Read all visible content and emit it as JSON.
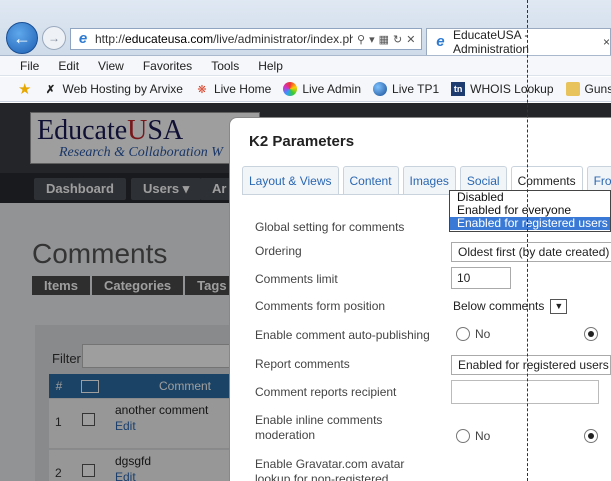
{
  "browser": {
    "url_prefix": "http://",
    "url_host": "educateusa.com",
    "url_path": "/live/administrator/index.ph",
    "tab_title": "EducateUSA - Administration",
    "tab_close": "×"
  },
  "menu": [
    "File",
    "Edit",
    "View",
    "Favorites",
    "Tools",
    "Help"
  ],
  "favorites": [
    {
      "label": "Web Hosting by Arvixe",
      "icon": "x-icon"
    },
    {
      "label": "Live Home",
      "icon": "joomla-icon"
    },
    {
      "label": "Live Admin",
      "icon": "colorball-icon"
    },
    {
      "label": "Live TP1",
      "icon": "globe-icon"
    },
    {
      "label": "WHOIS Lookup",
      "icon": "tn-icon",
      "icon_text": "tn"
    },
    {
      "label": "Guns ▾",
      "icon": "folder-icon"
    }
  ],
  "site": {
    "logo_main": "Educate",
    "logo_u": "U",
    "logo_sa": "SA",
    "logo_sub": "Research & Collaboration W",
    "nav": [
      "Dashboard",
      "Users ▾",
      "Ar"
    ],
    "page_title": "Comments",
    "sub_tabs": [
      "Items",
      "Categories",
      "Tags"
    ],
    "filter_label": "Filter",
    "table_headers": {
      "num": "#",
      "comment": "Comment"
    },
    "rows": [
      {
        "num": "1",
        "text": "another comment",
        "edit": "Edit"
      },
      {
        "num": "2",
        "text": "dgsgfd",
        "edit": "Edit"
      }
    ]
  },
  "modal": {
    "title": "K2 Parameters",
    "tabs": [
      "Layout & Views",
      "Content",
      "Images",
      "Social",
      "Comments",
      "Front"
    ],
    "active_tab": "Comments",
    "params": {
      "global_label": "Global setting for comments",
      "ordering_label": "Ordering",
      "ordering_value": "Oldest first (by date created)",
      "limit_label": "Comments limit",
      "limit_value": "10",
      "form_position_label": "Comments form position",
      "form_position_value": "Below comments",
      "autopublish_label": "Enable comment auto-publishing",
      "autopublish_no": "No",
      "report_label": "Report comments",
      "report_value": "Enabled for registered users o",
      "recipient_label": "Comment reports recipient",
      "inline_label_1": "Enable inline comments",
      "inline_label_2": "moderation",
      "inline_no": "No",
      "gravatar_label_1": "Enable Gravatar.com avatar",
      "gravatar_label_2": "lookup for non-registered"
    },
    "dropdown_options": [
      "Disabled",
      "Enabled for everyone",
      "Enabled for registered users o"
    ],
    "dropdown_selected_index": 2
  }
}
